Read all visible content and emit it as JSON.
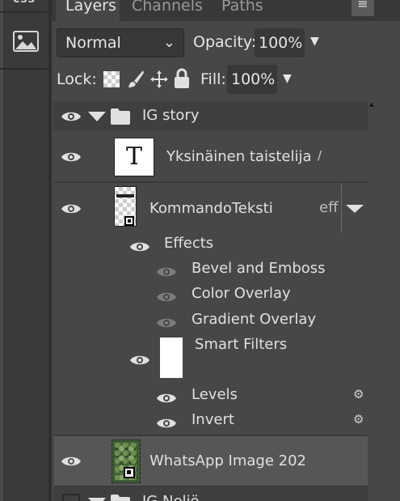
{
  "sidebar": {
    "css_label": "css",
    "image_icon": "image-icon"
  },
  "tabs": [
    {
      "label": "Layers"
    },
    {
      "label": "Channels"
    },
    {
      "label": "Paths"
    }
  ],
  "panel_menu_glyph": "≡",
  "blend": {
    "mode": "Normal"
  },
  "opacity": {
    "label": "Opacity:",
    "value": "100%"
  },
  "lock": {
    "label": "Lock:"
  },
  "fill": {
    "label": "Fill:",
    "value": "100%"
  },
  "layers": {
    "group1": {
      "name": "IG story"
    },
    "text_layer": {
      "name": "Yksinäinen taistelija",
      "thumb_glyph": "T",
      "mark": "/"
    },
    "kommando": {
      "name": "KommandoTeksti",
      "fx_label": "eff"
    },
    "effects": {
      "label": "Effects",
      "items": [
        {
          "label": "Bevel and Emboss"
        },
        {
          "label": "Color Overlay"
        },
        {
          "label": "Gradient Overlay"
        }
      ]
    },
    "smart_filters": {
      "label": "Smart Filters",
      "items": [
        {
          "label": "Levels"
        },
        {
          "label": "Invert"
        }
      ]
    },
    "whatsapp": {
      "name": "WhatsApp Image 202"
    },
    "group2": {
      "name": "IG Neliö"
    }
  },
  "colors": {
    "panel_bg": "#474747",
    "dark_bg": "#383838",
    "selected_row": "#565656",
    "text": "#e0e0e0"
  }
}
